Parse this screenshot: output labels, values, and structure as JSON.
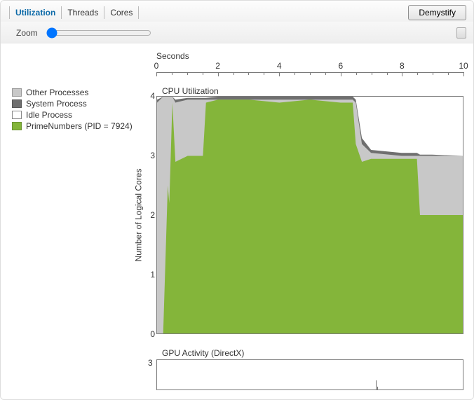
{
  "tabs": {
    "items": [
      "Utilization",
      "Threads",
      "Cores"
    ],
    "active": "Utilization"
  },
  "buttons": {
    "demystify": "Demystify"
  },
  "zoom": {
    "label": "Zoom",
    "value": 0
  },
  "legend": {
    "items": [
      {
        "key": "other",
        "label": "Other Processes"
      },
      {
        "key": "system",
        "label": "System Process"
      },
      {
        "key": "idle",
        "label": "Idle Process"
      },
      {
        "key": "prime",
        "label": "PrimeNumbers (PID = 7924)"
      }
    ]
  },
  "colors": {
    "other": "#c8c8c8",
    "system": "#6f6f6f",
    "idle": "#ffffff",
    "prime": "#84b53a"
  },
  "chart_data": {
    "type": "area",
    "title": "CPU Utilization",
    "xlabel": "Seconds",
    "ylabel": "Number of Logical Cores",
    "xlim": [
      0,
      10
    ],
    "ylim": [
      0,
      4
    ],
    "xticks": [
      0,
      2,
      4,
      6,
      8,
      10
    ],
    "yticks": [
      0,
      1,
      2,
      3,
      4
    ],
    "x": [
      0.0,
      0.2,
      0.35,
      0.4,
      0.5,
      0.6,
      1.0,
      1.5,
      1.6,
      2.0,
      3.0,
      4.0,
      5.0,
      6.0,
      6.4,
      6.5,
      6.7,
      7.0,
      8.0,
      8.5,
      8.6,
      9.0,
      10.0
    ],
    "series": [
      {
        "name": "PrimeNumbers (PID = 7924)",
        "color": "#84b53a",
        "values": [
          0.0,
          0.0,
          2.5,
          2.2,
          3.9,
          2.9,
          3.0,
          3.0,
          3.9,
          3.95,
          3.95,
          3.9,
          3.95,
          3.9,
          3.9,
          3.2,
          2.9,
          2.95,
          2.95,
          2.95,
          2.0,
          2.0,
          2.0
        ]
      },
      {
        "name": "Other Processes",
        "color": "#c8c8c8",
        "values": [
          3.9,
          4.0,
          4.0,
          4.0,
          4.0,
          3.9,
          3.95,
          3.95,
          3.95,
          3.95,
          3.95,
          3.95,
          3.95,
          3.95,
          3.95,
          3.9,
          3.2,
          3.05,
          3.0,
          3.0,
          3.0,
          3.0,
          3.0
        ]
      },
      {
        "name": "System Process",
        "color": "#6f6f6f",
        "values": [
          3.95,
          4.0,
          4.0,
          4.0,
          4.0,
          3.95,
          3.98,
          3.98,
          3.98,
          4.0,
          4.0,
          4.0,
          4.0,
          4.0,
          4.0,
          3.95,
          3.3,
          3.1,
          3.05,
          3.05,
          3.02,
          3.02,
          3.0
        ]
      }
    ],
    "note": "Stacked cumulative series: prime ≤ other ≤ system ≤ 4. Idle = 4 − system."
  },
  "gpu": {
    "title": "GPU Activity (DirectX)",
    "ymax": 3,
    "ytick": 3,
    "spikes": [
      {
        "x": 7.15,
        "h": 0.9
      },
      {
        "x": 7.2,
        "h": 0.3
      }
    ]
  }
}
